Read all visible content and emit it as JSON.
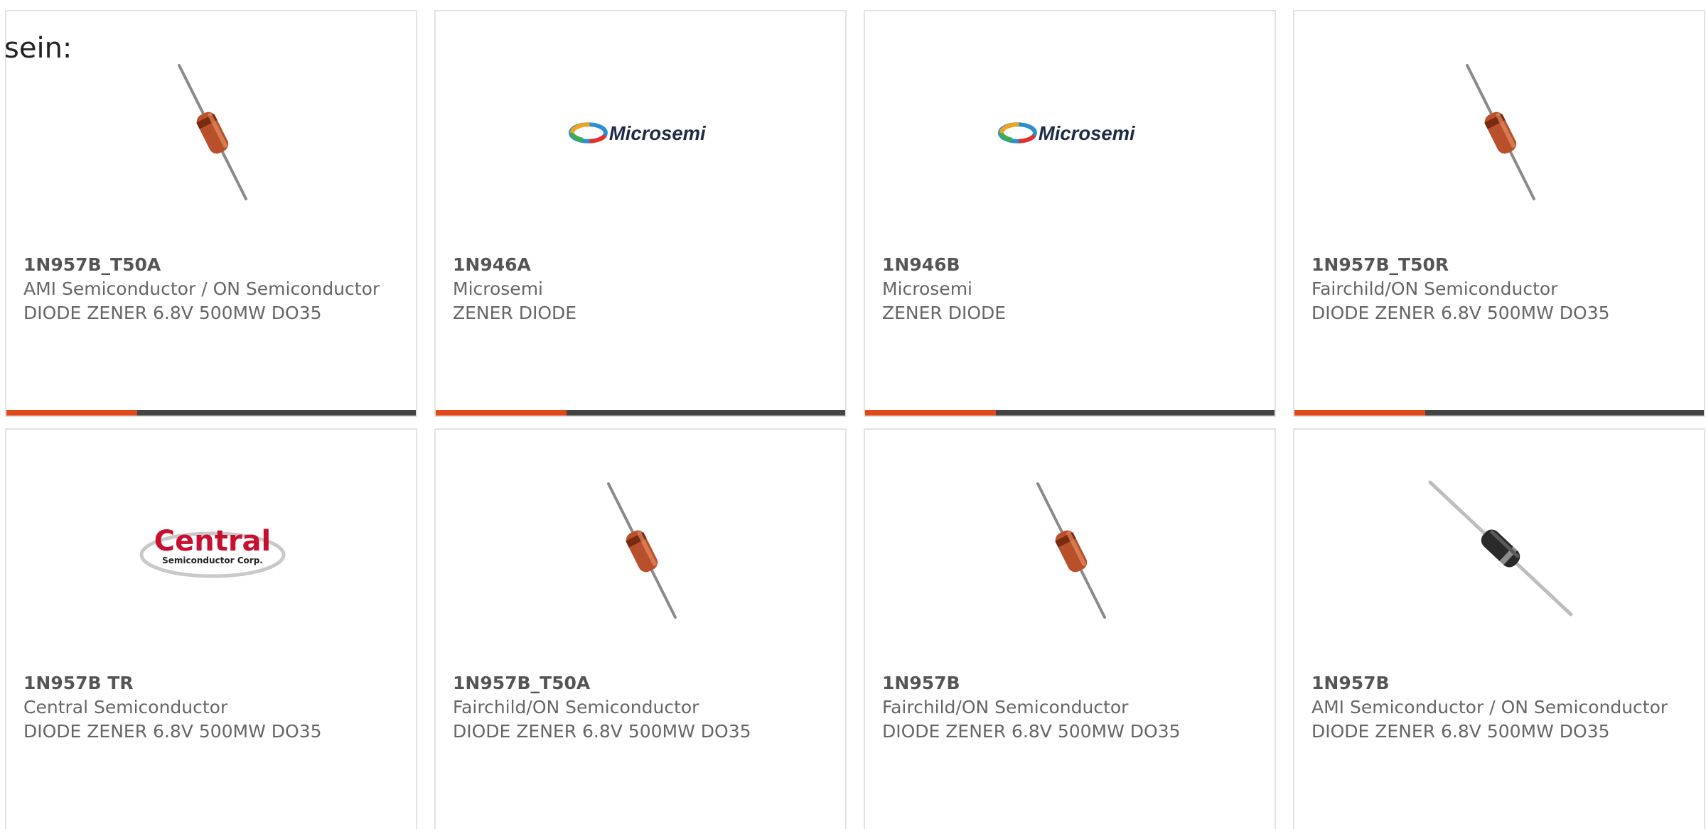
{
  "lead_text": "sein:",
  "colors": {
    "accent": "#e04a1b",
    "bar_dark": "#444444",
    "text": "#666666",
    "border": "#e3e3e3"
  },
  "cards": [
    {
      "part_number": "1N957B_T50A",
      "manufacturer": "AMI Semiconductor / ON Semiconductor",
      "description": "DIODE ZENER 6.8V 500MW DO35",
      "image": "glass-diode-icon",
      "bar_progress": 0.32
    },
    {
      "part_number": "1N946A",
      "manufacturer": "Microsemi",
      "description": "ZENER DIODE",
      "image": "microsemi-logo",
      "logo_text": "Microsemi",
      "bar_progress": 0.32
    },
    {
      "part_number": "1N946B",
      "manufacturer": "Microsemi",
      "description": "ZENER DIODE",
      "image": "microsemi-logo",
      "logo_text": "Microsemi",
      "bar_progress": 0.32
    },
    {
      "part_number": "1N957B_T50R",
      "manufacturer": "Fairchild/ON Semiconductor",
      "description": "DIODE ZENER 6.8V 500MW DO35",
      "image": "glass-diode-icon",
      "bar_progress": 0.32
    },
    {
      "part_number": "1N957B TR",
      "manufacturer": "Central Semiconductor",
      "description": "DIODE ZENER 6.8V 500MW DO35",
      "image": "central-logo",
      "logo_text": "Central",
      "logo_subtext": "Semiconductor Corp.",
      "bar_progress": 0.32
    },
    {
      "part_number": "1N957B_T50A",
      "manufacturer": "Fairchild/ON Semiconductor",
      "description": "DIODE ZENER 6.8V 500MW DO35",
      "image": "glass-diode-icon",
      "bar_progress": 0.32
    },
    {
      "part_number": "1N957B",
      "manufacturer": "Fairchild/ON Semiconductor",
      "description": "DIODE ZENER 6.8V 500MW DO35",
      "image": "glass-diode-icon",
      "bar_progress": 0.32
    },
    {
      "part_number": "1N957B",
      "manufacturer": "AMI Semiconductor / ON Semiconductor",
      "description": "DIODE ZENER 6.8V 500MW DO35",
      "image": "black-diode-icon",
      "bar_progress": 0.32
    }
  ]
}
